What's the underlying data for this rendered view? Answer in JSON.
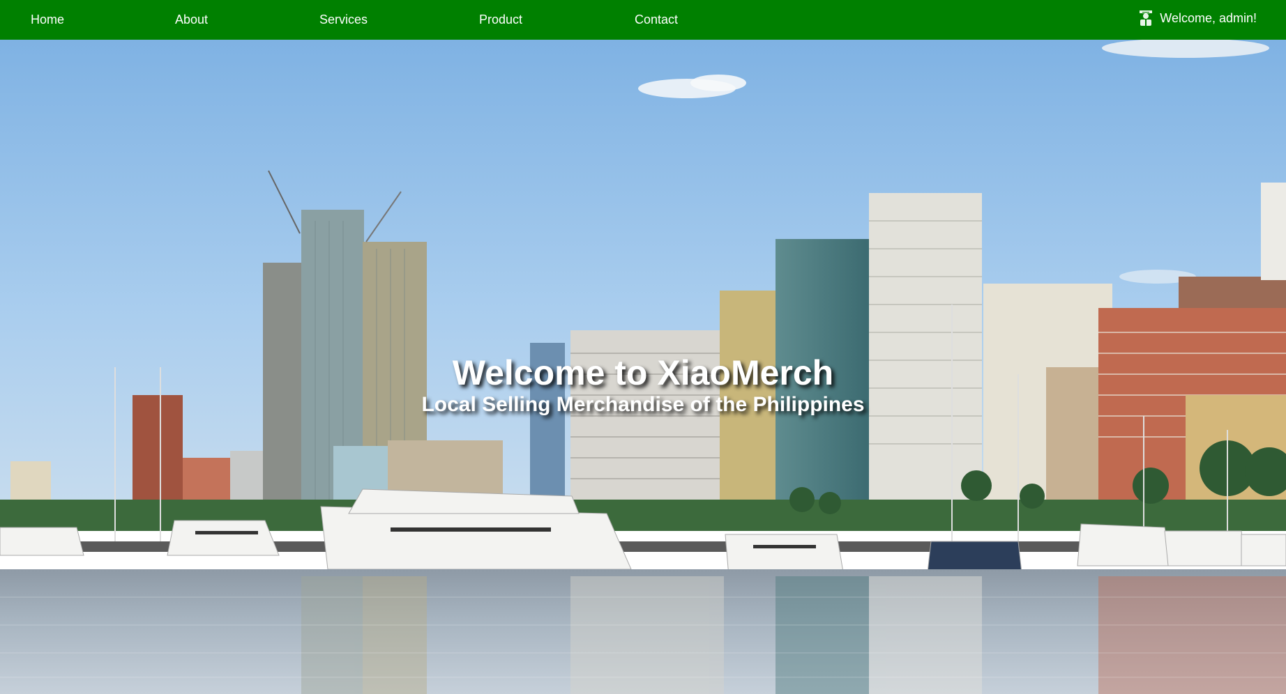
{
  "nav": {
    "items": [
      {
        "label": "Home"
      },
      {
        "label": "About"
      },
      {
        "label": "Services"
      },
      {
        "label": "Product"
      },
      {
        "label": "Contact"
      }
    ],
    "user_icon": "admin-user-icon",
    "welcome_text": "Welcome, admin!",
    "background_color": "#008000"
  },
  "hero": {
    "title": "Welcome to XiaoMerch",
    "subtitle": "Local Selling Merchandise of the Philippines",
    "background_image": "city skyline-with-marina-photo"
  }
}
